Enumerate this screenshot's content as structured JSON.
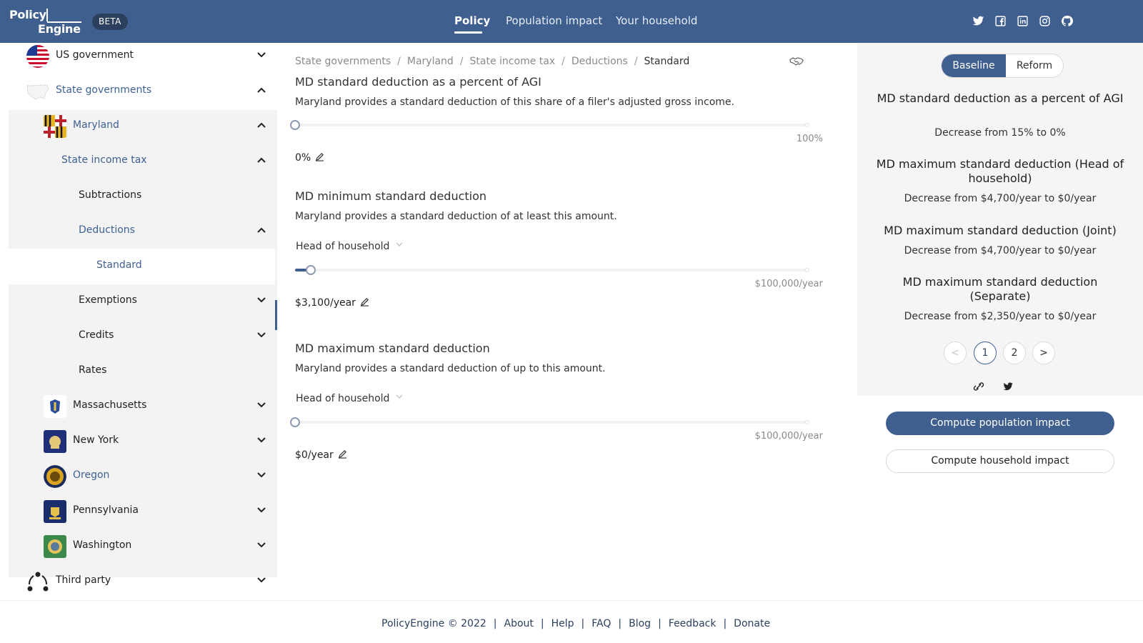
{
  "header": {
    "logo_line1": "Policy",
    "logo_line2": "Engine",
    "beta": "BETA",
    "tabs": [
      {
        "label": "Policy",
        "active": true
      },
      {
        "label": "Population impact",
        "active": false
      },
      {
        "label": "Your household",
        "active": false
      }
    ],
    "social_icons": [
      "twitter-icon",
      "facebook-icon",
      "linkedin-icon",
      "instagram-icon",
      "github-icon"
    ]
  },
  "sidebar": {
    "items": [
      {
        "label": "US government",
        "icon": "us-flag",
        "expanded": false
      },
      {
        "label": "State governments",
        "icon": "us-map",
        "expanded": true
      },
      {
        "label": "Maryland",
        "icon": "maryland-flag",
        "expanded": true
      },
      {
        "label": "State income tax",
        "expanded": true
      },
      {
        "label": "Subtractions"
      },
      {
        "label": "Deductions",
        "expanded": true
      },
      {
        "label": "Standard",
        "selected": true
      },
      {
        "label": "Exemptions",
        "expanded": false
      },
      {
        "label": "Credits",
        "expanded": false
      },
      {
        "label": "Rates"
      },
      {
        "label": "Massachusetts",
        "icon": "massachusetts-flag",
        "expanded": false
      },
      {
        "label": "New York",
        "icon": "new-york-flag",
        "expanded": false
      },
      {
        "label": "Oregon",
        "icon": "oregon-flag",
        "expanded": false
      },
      {
        "label": "Pennsylvania",
        "icon": "pennsylvania-flag",
        "expanded": false
      },
      {
        "label": "Washington",
        "icon": "washington-flag",
        "expanded": false
      },
      {
        "label": "Third party",
        "icon": "third-party-icon",
        "expanded": false
      }
    ]
  },
  "main": {
    "breadcrumb": [
      "State governments",
      "Maryland",
      "State income tax",
      "Deductions",
      "Standard"
    ],
    "params": [
      {
        "title": "MD standard deduction as a percent of AGI",
        "description": "Maryland provides a standard deduction of this share of a filer's adjusted gross income.",
        "slider_max": "100%",
        "value": "0%",
        "slider_fraction": 0
      },
      {
        "title": "MD minimum standard deduction",
        "description": "Maryland provides a standard deduction of at least this amount.",
        "filing_status": "Head of household",
        "slider_max": "$100,000/year",
        "value": "$3,100/year",
        "slider_fraction": 0.031
      },
      {
        "title": "MD maximum standard deduction",
        "description": "Maryland provides a standard deduction of up to this amount.",
        "filing_status": "Head of household",
        "slider_max": "$100,000/year",
        "value": "$0/year",
        "slider_fraction": 0
      }
    ]
  },
  "right": {
    "baseline": "Baseline",
    "reform": "Reform",
    "changes": [
      {
        "title": "MD standard deduction as a percent of AGI",
        "desc": "Decrease from 15% to 0%"
      },
      {
        "title": "MD maximum standard deduction (Head of household)",
        "desc": "Decrease from $4,700/year to $0/year"
      },
      {
        "title": "MD maximum standard deduction (Joint)",
        "desc": "Decrease from $4,700/year to $0/year"
      },
      {
        "title": "MD maximum standard deduction (Separate)",
        "desc": "Decrease from $2,350/year to $0/year"
      }
    ],
    "pagination": {
      "prev": "<",
      "pages": [
        "1",
        "2"
      ],
      "next": ">"
    },
    "compute_population": "Compute population impact",
    "compute_household": "Compute household impact"
  },
  "footer": {
    "copyright": "PolicyEngine © 2022",
    "links": [
      "About",
      "Help",
      "FAQ",
      "Blog",
      "Feedback",
      "Donate"
    ]
  },
  "colors": {
    "brand": "#3f5f8f",
    "dark_brand": "#2b3f5e"
  }
}
